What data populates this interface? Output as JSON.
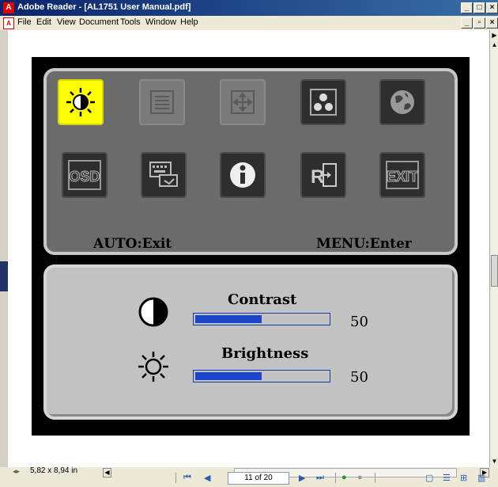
{
  "window": {
    "title": "Adobe Reader - [AL1751 User Manual.pdf]",
    "app_icon": "pdf-app-icon",
    "buttons": [
      "_",
      "□",
      "×"
    ]
  },
  "menubar": {
    "items": [
      "File",
      "Edit",
      "View",
      "Document",
      "Tools",
      "Window",
      "Help"
    ],
    "doc_buttons": [
      "_",
      "▫",
      "×"
    ]
  },
  "osd": {
    "row1_icons": [
      "brightness-sun-icon",
      "lines-icon",
      "position-arrows-icon",
      "color-dots-icon",
      "globe-icon"
    ],
    "row2_icons": [
      "osd-icon",
      "display-input-icon",
      "info-icon",
      "reset-icon",
      "exit-icon"
    ],
    "osd_label": "OSD",
    "exit_label": "EXIT",
    "auto_hint": "AUTO:Exit",
    "menu_hint": "MENU:Enter",
    "settings": [
      {
        "label": "Contrast",
        "value": "50",
        "fraction": 0.5,
        "icon": "contrast-icon"
      },
      {
        "label": "Brightness",
        "value": "50",
        "fraction": 0.5,
        "icon": "sun-icon"
      }
    ]
  },
  "status": {
    "page_size": "5,82 x 8,94 in",
    "page_field": "11 of 20"
  },
  "colors": {
    "selected_tile": "#ffff00",
    "bar_fill": "#1c44c8",
    "titlebar": "#0a246a"
  }
}
